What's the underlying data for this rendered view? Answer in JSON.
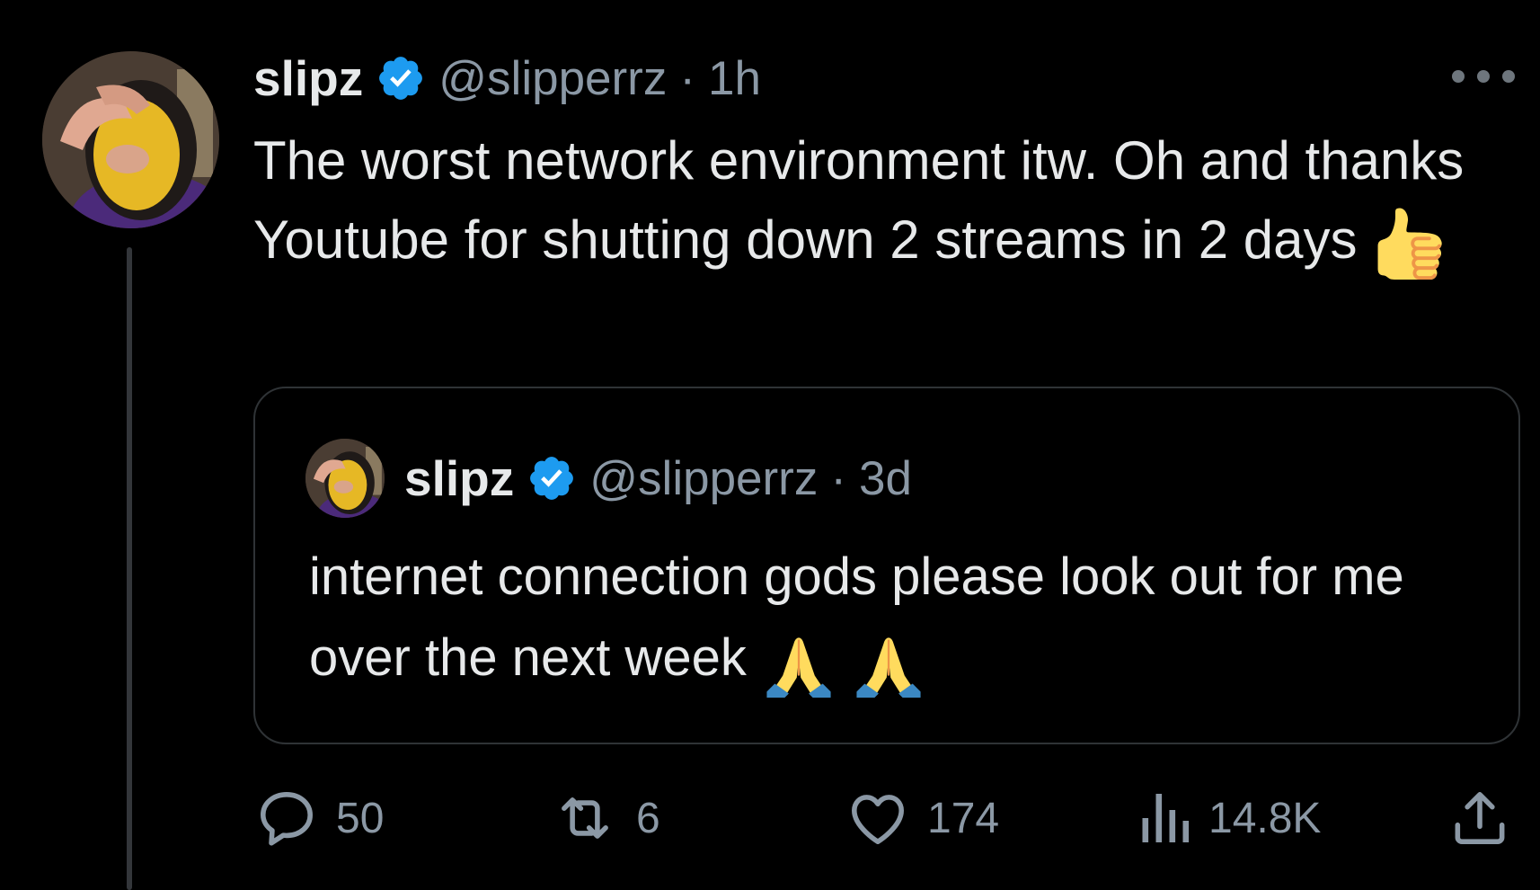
{
  "tweet": {
    "author_name": "slipz",
    "handle": "@slipperrz",
    "separator": "·",
    "time": "1h",
    "text": "The worst network environment itw. Oh and thanks Youtube for shutting down 2 streams in 2 days",
    "text_emoji": "thumbs-up-emoji",
    "more_icon": "more-options-icon"
  },
  "quote": {
    "author_name": "slipz",
    "handle": "@slipperrz",
    "separator": "·",
    "time": "3d",
    "text": "internet connection gods please look out for me over the next week",
    "text_emojis": [
      "folded-hands-emoji",
      "folded-hands-emoji"
    ]
  },
  "actions": {
    "reply": {
      "icon": "reply-icon",
      "count": "50"
    },
    "retweet": {
      "icon": "retweet-icon",
      "count": "6"
    },
    "like": {
      "icon": "heart-icon",
      "count": "174"
    },
    "views": {
      "icon": "views-icon",
      "count": "14.8K"
    },
    "share": {
      "icon": "share-icon"
    }
  },
  "colors": {
    "background": "#000000",
    "text_primary": "#e7e9ea",
    "text_secondary": "#8b98a5",
    "verified_blue": "#1d9bf0",
    "border": "#2f3336"
  }
}
